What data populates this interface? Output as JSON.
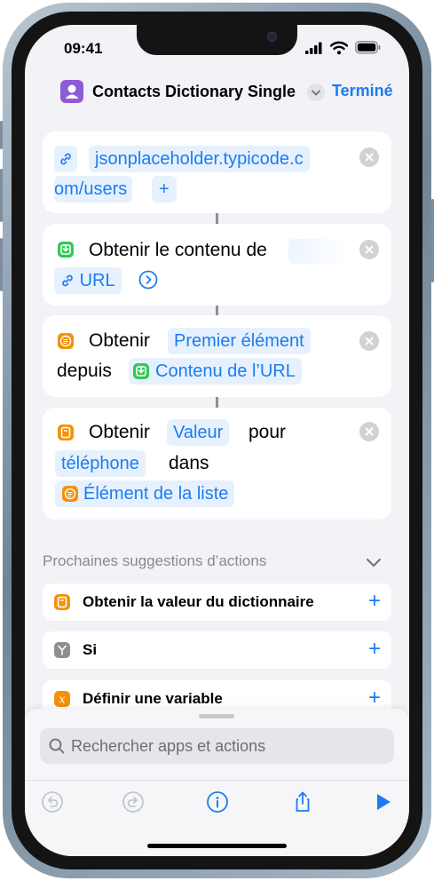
{
  "status_bar": {
    "time": "09:41"
  },
  "header": {
    "title": "Contacts Dictionary Single",
    "done_label": "Terminé"
  },
  "actions": [
    {
      "url_line1": "jsonplaceholder.typicode.c",
      "url_line2": "om/users",
      "plus": "+"
    },
    {
      "text": "Obtenir le contenu de",
      "param": "URL"
    },
    {
      "verb": "Obtenir",
      "param": "Premier élément",
      "prep": "depuis",
      "source": "Contenu de l’URL"
    },
    {
      "verb": "Obtenir",
      "param": "Valeur",
      "prep": "pour",
      "key": "téléphone",
      "prep2": "dans",
      "source": "Élément de la liste"
    }
  ],
  "suggestions": {
    "heading": "Prochaines suggestions d’actions",
    "items": [
      {
        "label": "Obtenir la valeur du dictionnaire",
        "plus": "+"
      },
      {
        "label": "Si",
        "plus": "+"
      },
      {
        "label": "Définir une variable",
        "plus": "+"
      }
    ]
  },
  "search": {
    "placeholder": "Rechercher apps et actions"
  },
  "colors": {
    "accent": "#1a7cf0",
    "orange": "#f3910b",
    "green": "#34c759",
    "purple": "#8e5bd6",
    "gray": "#8e8e93"
  }
}
